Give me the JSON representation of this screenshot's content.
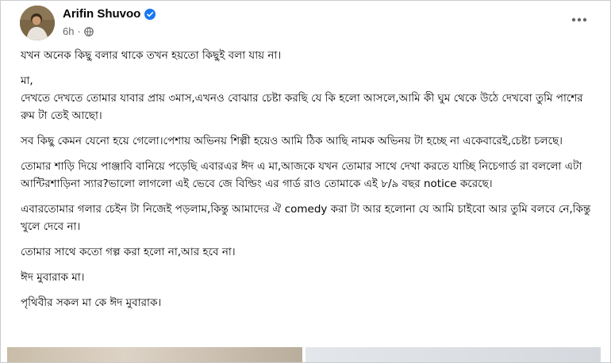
{
  "post": {
    "author": "Arifin Shuvoo",
    "time": "6h",
    "verified_icon": "verified-badge-icon",
    "audience_icon": "globe-icon",
    "accent_color": "#1877f2",
    "paragraphs": [
      "যখন অনেক কিছু বলার থাকে তখন হয়তো কিছুই বলা যায় না।",
      "মা,\nদেখতে দেখতে তোমার যাবার প্রায় ৩মাস,এখনও বোঝার চেষ্টা করছি যে কি হলো আসলে,আমি কী ঘুম থেকে উঠে দেখবো তুমি পাশের রুম টা তেই আছো।",
      "সব কিছু কেমন যেনো হয়ে গেলো।পেশায় অভিনয় শিল্পী হয়েও আমি ঠিক আছি নামক অভিনয় টা হচ্ছে না একেবারেই,চেষ্টা চলছে।",
      "তোমার শাড়ি দিয়ে পাঞ্জাবি বানিয়ে পড়েছি এবারএর ঈদ এ মা,আজকে যখন তোমার সাথে দেখা করতে যাচ্ছি নিচেগার্ড রা বললো এটা আন্টিরশাড়িনা স্যার?ভালো লাগলো এই ভেবে জে বিল্ডিং এর গার্ড রাও তোমাকে এই ৮/৯ বছর notice করেছে।",
      "এবারতোমার গলার চেইন টা নিজেই পড়লাম,কিন্তু আমাদের ঐ comedy করা টা আর হলোনা যে আমি চাইবো আর তুমি বলবে নে,কিন্তু খুলে দেবে না।",
      "তোমার সাথে কতো গল্প করা হলো না,আর হবে না।",
      "ঈদ মুবারাক মা।",
      "পৃথিবীর সকল মা কে ঈদ মুবারাক।"
    ]
  }
}
